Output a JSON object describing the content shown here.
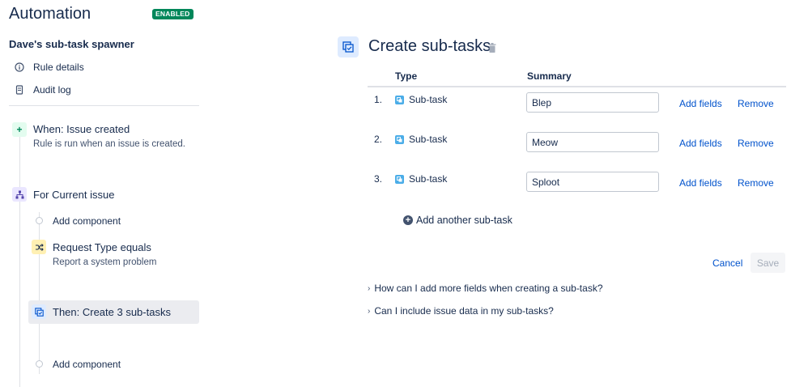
{
  "app": {
    "title": "Automation",
    "status_badge": "ENABLED"
  },
  "sidebar": {
    "rule_name": "Dave's sub-task spawner",
    "nav": [
      {
        "label": "Rule details",
        "icon": "info-icon"
      },
      {
        "label": "Audit log",
        "icon": "document-icon"
      }
    ]
  },
  "components": {
    "trigger": {
      "title": "When: Issue created",
      "subtitle": "Rule is run when an issue is created.",
      "icon": "plus-icon"
    },
    "branch": {
      "title": "For Current issue",
      "icon": "branch-icon"
    },
    "add_component_1": "Add component",
    "condition": {
      "title": "Request Type equals",
      "subtitle": "Report a system problem",
      "icon": "shuffle-icon"
    },
    "action": {
      "title": "Then: Create 3 sub-tasks",
      "icon": "subtask-icon"
    },
    "add_component_2": "Add component"
  },
  "editor": {
    "title": "Create sub-tasks",
    "columns": {
      "type": "Type",
      "summary": "Summary"
    },
    "rows": [
      {
        "num": "1.",
        "type": "Sub-task",
        "summary": "Blep",
        "add_fields": "Add fields",
        "remove": "Remove"
      },
      {
        "num": "2.",
        "type": "Sub-task",
        "summary": "Meow",
        "add_fields": "Add fields",
        "remove": "Remove"
      },
      {
        "num": "3.",
        "type": "Sub-task",
        "summary": "Sploot",
        "add_fields": "Add fields",
        "remove": "Remove"
      }
    ],
    "add_another": "Add another sub-task",
    "cancel": "Cancel",
    "save": "Save",
    "faqs": [
      "How can I add more fields when creating a sub-task?",
      "Can I include issue data in my sub-tasks?"
    ]
  },
  "colors": {
    "accent": "#0052cc",
    "enabled": "#00875a",
    "trigger": "#e3fcef",
    "branch": "#eae6ff",
    "condition": "#fff0b3",
    "action": "#deebff"
  }
}
